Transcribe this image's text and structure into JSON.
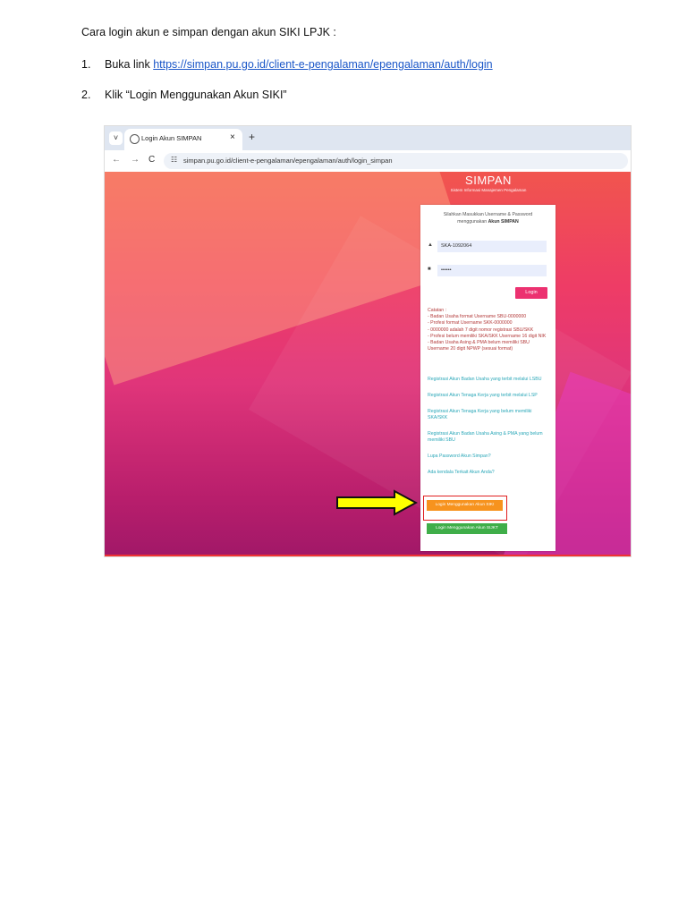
{
  "document": {
    "heading": "Cara login akun e simpan dengan akun SIKI LPJK :",
    "steps": [
      {
        "number": "1.",
        "prefix": "Buka link ",
        "link": "https://simpan.pu.go.id/client-e-pengalaman/epengalaman/auth/login"
      },
      {
        "number": "2.",
        "text": "Klik “Login Menggunakan Akun SIKI”"
      }
    ]
  },
  "browser": {
    "tab_title": "Login Akun SIMPAN",
    "tab_close": "×",
    "new_tab": "+",
    "menu_glyph": "˅",
    "back": "←",
    "forward": "→",
    "reload": "C",
    "tune": "☷",
    "url": "simpan.pu.go.id/client-e-pengalaman/epengalaman/auth/login_simpan"
  },
  "app": {
    "title": "SIMPAN",
    "subtitle": "Sistem Informasi Manajemen Pengalaman",
    "intro_line1": "Silahkan Masukkan Username & Password",
    "intro_line2": "menggunakan ",
    "intro_bold": "Akun SIMPAN",
    "username_value": "SKA-1092064",
    "password_value": "••••••",
    "user_icon": "▲",
    "lock_icon": "■",
    "login_button": "Login",
    "notes": [
      "Catatan :",
      "- Badan Usaha format Username SBU-0000000",
      "- Profesi format Username SKK-0000000",
      "- 0000000 adalah 7 digit nomor registrasi SBU/SKK",
      "- Profesi belum memiliki SKA/SKK Username 16 digit NIK",
      "- Badan Usaha Asing & PMA belum memiliki SBU Username 20 digit NPWP (sesuai format)"
    ],
    "links": [
      "Registrasi Akun Badan Usaha yang terbit melalui LSBU",
      "Registrasi Akun Tenaga Kerja yang terbit melalui LSP",
      "Registrasi Akun Tenaga Kerja yang belum memiliki SKA/SKK",
      "Registrasi Akun Badan Usaha Asing & PMA yang belum memiliki SBU",
      "Lupa Password Akun Simpan?",
      "Ada kendala Terkait Akun Anda?"
    ],
    "siki_button": "Login Menggunakan Akun SIKI",
    "sijkt_button": "Login Menggunakan Akun SIJKT"
  },
  "colors": {
    "link": "#1a56c8",
    "login_button": "#ec3170",
    "siki_button": "#f7931e",
    "sijkt_button": "#3fae49",
    "highlight_box": "#e02020",
    "arrow": "#ffff00"
  }
}
